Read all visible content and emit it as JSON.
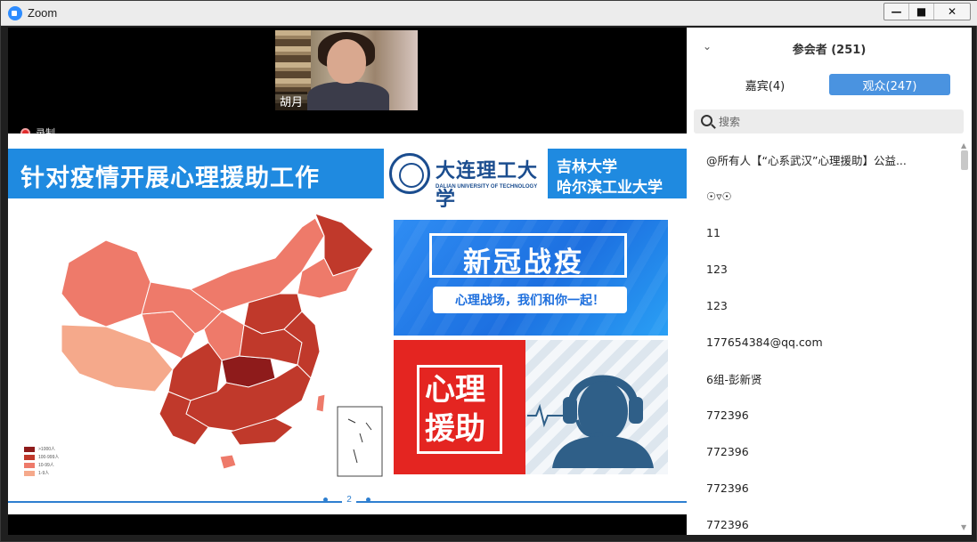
{
  "window": {
    "app_title": "Zoom",
    "controls": {
      "minimize": "—",
      "maximize": "■",
      "close": "✕"
    }
  },
  "video": {
    "speaker_name": "胡月",
    "recording_label": "录制"
  },
  "slide": {
    "title": "针对疫情开展心理援助工作",
    "logo_cn": "大连理工大学",
    "logo_en": "DALIAN UNIVERSITY OF TECHNOLOGY",
    "partner_line1": "吉林大学",
    "partner_line2": "哈尔滨工业大学",
    "panel1_title": "新冠战疫",
    "panel1_slogan": "心理战场，我们和你一起！",
    "panel2_text": "心理援助",
    "page_number": "2",
    "map_legend": [
      {
        "label": ">1000人",
        "color": "#8e1b1b"
      },
      {
        "label": "100-999人",
        "color": "#c0392b"
      },
      {
        "label": "10-99人",
        "color": "#ee7a6a"
      },
      {
        "label": "1-9人",
        "color": "#f5a98b"
      }
    ]
  },
  "participants": {
    "title": "参会者 (251)",
    "tabs": [
      {
        "label": "嘉宾(4)",
        "active": false
      },
      {
        "label": "观众(247)",
        "active": true
      }
    ],
    "search_placeholder": "搜索",
    "items": [
      "@所有人【“心系武汉”心理援助】公益...",
      "☉▿☉",
      "11",
      "123",
      "123",
      "177654384@qq.com",
      "6组-彭新贤",
      "772396",
      "772396",
      "772396",
      "772396"
    ]
  },
  "colors": {
    "accent": "#4a93e0",
    "slide_blue": "#1f8ae0",
    "help_red": "#e42521"
  }
}
